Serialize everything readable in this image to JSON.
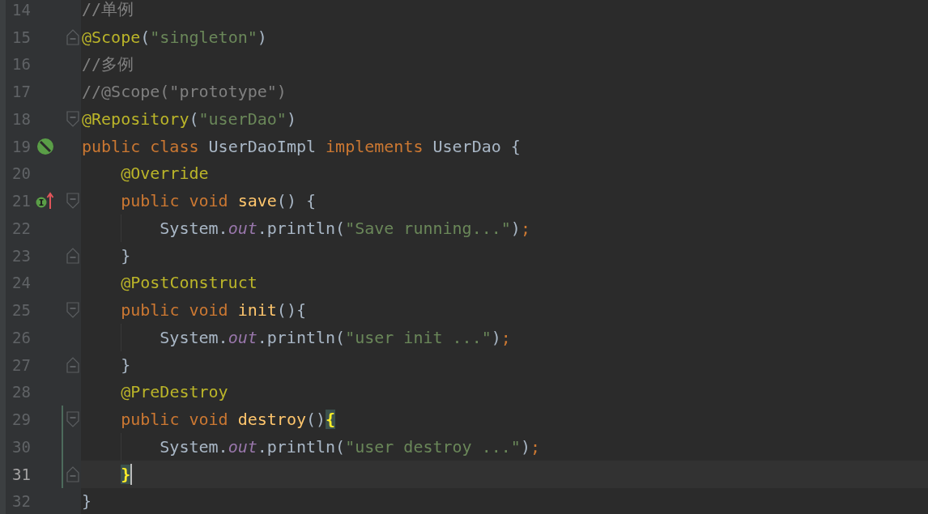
{
  "editor": {
    "lines": [
      {
        "number": "14",
        "current": false,
        "changed": false,
        "indent_guide": false,
        "fold_start": false,
        "fold_end": false,
        "tokens": [
          {
            "text": "//单例",
            "kind": "comment"
          }
        ]
      },
      {
        "number": "15",
        "current": false,
        "changed": false,
        "indent_guide": false,
        "fold_start": false,
        "fold_end": true,
        "tokens": [
          {
            "text": "@Scope",
            "kind": "annotation"
          },
          {
            "text": "(",
            "kind": "plain"
          },
          {
            "text": "\"singleton\"",
            "kind": "string"
          },
          {
            "text": ")",
            "kind": "plain"
          }
        ]
      },
      {
        "number": "16",
        "current": false,
        "changed": false,
        "indent_guide": false,
        "fold_start": false,
        "fold_end": false,
        "tokens": [
          {
            "text": "//多例",
            "kind": "comment"
          }
        ]
      },
      {
        "number": "17",
        "current": false,
        "changed": false,
        "indent_guide": false,
        "fold_start": false,
        "fold_end": false,
        "tokens": [
          {
            "text": "//@Scope(\"prototype\")",
            "kind": "comment"
          }
        ]
      },
      {
        "number": "18",
        "current": false,
        "changed": false,
        "indent_guide": false,
        "fold_start": true,
        "fold_end": false,
        "tokens": [
          {
            "text": "@Repository",
            "kind": "annotation"
          },
          {
            "text": "(",
            "kind": "plain"
          },
          {
            "text": "\"userDao\"",
            "kind": "string"
          },
          {
            "text": ")",
            "kind": "plain"
          }
        ]
      },
      {
        "number": "19",
        "current": false,
        "changed": false,
        "indent_guide": false,
        "fold_start": false,
        "fold_end": false,
        "tokens": [
          {
            "text": "public class ",
            "kind": "keyword"
          },
          {
            "text": "UserDaoImpl ",
            "kind": "plain"
          },
          {
            "text": "implements ",
            "kind": "keyword"
          },
          {
            "text": "UserDao {",
            "kind": "plain"
          }
        ]
      },
      {
        "number": "20",
        "current": false,
        "changed": false,
        "indent_guide": false,
        "fold_start": false,
        "fold_end": false,
        "tokens": [
          {
            "text": "    @Override",
            "kind": "annotation"
          }
        ]
      },
      {
        "number": "21",
        "current": false,
        "changed": false,
        "indent_guide": false,
        "fold_start": true,
        "fold_end": false,
        "tokens": [
          {
            "text": "    public void ",
            "kind": "keyword"
          },
          {
            "text": "save",
            "kind": "method"
          },
          {
            "text": "() {",
            "kind": "plain"
          }
        ]
      },
      {
        "number": "22",
        "current": false,
        "changed": false,
        "indent_guide": true,
        "fold_start": false,
        "fold_end": false,
        "tokens": [
          {
            "text": "        System.",
            "kind": "plain"
          },
          {
            "text": "out",
            "kind": "field"
          },
          {
            "text": ".println(",
            "kind": "plain"
          },
          {
            "text": "\"Save running...\"",
            "kind": "string"
          },
          {
            "text": ")",
            "kind": "plain"
          },
          {
            "text": ";",
            "kind": "keyword"
          }
        ]
      },
      {
        "number": "23",
        "current": false,
        "changed": false,
        "indent_guide": false,
        "fold_start": false,
        "fold_end": true,
        "tokens": [
          {
            "text": "    }",
            "kind": "plain"
          }
        ]
      },
      {
        "number": "24",
        "current": false,
        "changed": false,
        "indent_guide": false,
        "fold_start": false,
        "fold_end": false,
        "tokens": [
          {
            "text": "    @PostConstruct",
            "kind": "annotation"
          }
        ]
      },
      {
        "number": "25",
        "current": false,
        "changed": false,
        "indent_guide": false,
        "fold_start": true,
        "fold_end": false,
        "tokens": [
          {
            "text": "    public void ",
            "kind": "keyword"
          },
          {
            "text": "init",
            "kind": "method"
          },
          {
            "text": "(){",
            "kind": "plain"
          }
        ]
      },
      {
        "number": "26",
        "current": false,
        "changed": false,
        "indent_guide": true,
        "fold_start": false,
        "fold_end": false,
        "tokens": [
          {
            "text": "        System.",
            "kind": "plain"
          },
          {
            "text": "out",
            "kind": "field"
          },
          {
            "text": ".println(",
            "kind": "plain"
          },
          {
            "text": "\"user init ...\"",
            "kind": "string"
          },
          {
            "text": ")",
            "kind": "plain"
          },
          {
            "text": ";",
            "kind": "keyword"
          }
        ]
      },
      {
        "number": "27",
        "current": false,
        "changed": false,
        "indent_guide": false,
        "fold_start": false,
        "fold_end": true,
        "tokens": [
          {
            "text": "    }",
            "kind": "plain"
          }
        ]
      },
      {
        "number": "28",
        "current": false,
        "changed": false,
        "indent_guide": false,
        "fold_start": false,
        "fold_end": false,
        "tokens": [
          {
            "text": "    @PreDestroy",
            "kind": "annotation"
          }
        ]
      },
      {
        "number": "29",
        "current": false,
        "changed": true,
        "indent_guide": false,
        "fold_start": true,
        "fold_end": false,
        "tokens": [
          {
            "text": "    public void ",
            "kind": "keyword"
          },
          {
            "text": "destroy",
            "kind": "method"
          },
          {
            "text": "()",
            "kind": "plain"
          },
          {
            "text": "{",
            "kind": "brace-match"
          }
        ]
      },
      {
        "number": "30",
        "current": false,
        "changed": true,
        "indent_guide": true,
        "fold_start": false,
        "fold_end": false,
        "tokens": [
          {
            "text": "        System.",
            "kind": "plain"
          },
          {
            "text": "out",
            "kind": "field"
          },
          {
            "text": ".println(",
            "kind": "plain"
          },
          {
            "text": "\"user destroy ...\"",
            "kind": "string"
          },
          {
            "text": ")",
            "kind": "plain"
          },
          {
            "text": ";",
            "kind": "keyword"
          }
        ]
      },
      {
        "number": "31",
        "current": true,
        "changed": true,
        "indent_guide": false,
        "fold_start": false,
        "fold_end": true,
        "tokens": [
          {
            "text": "    }",
            "kind": "brace-match"
          }
        ]
      },
      {
        "number": "32",
        "current": false,
        "changed": false,
        "indent_guide": false,
        "fold_start": false,
        "fold_end": false,
        "tokens": [
          {
            "text": "}",
            "kind": "plain"
          }
        ]
      }
    ]
  }
}
